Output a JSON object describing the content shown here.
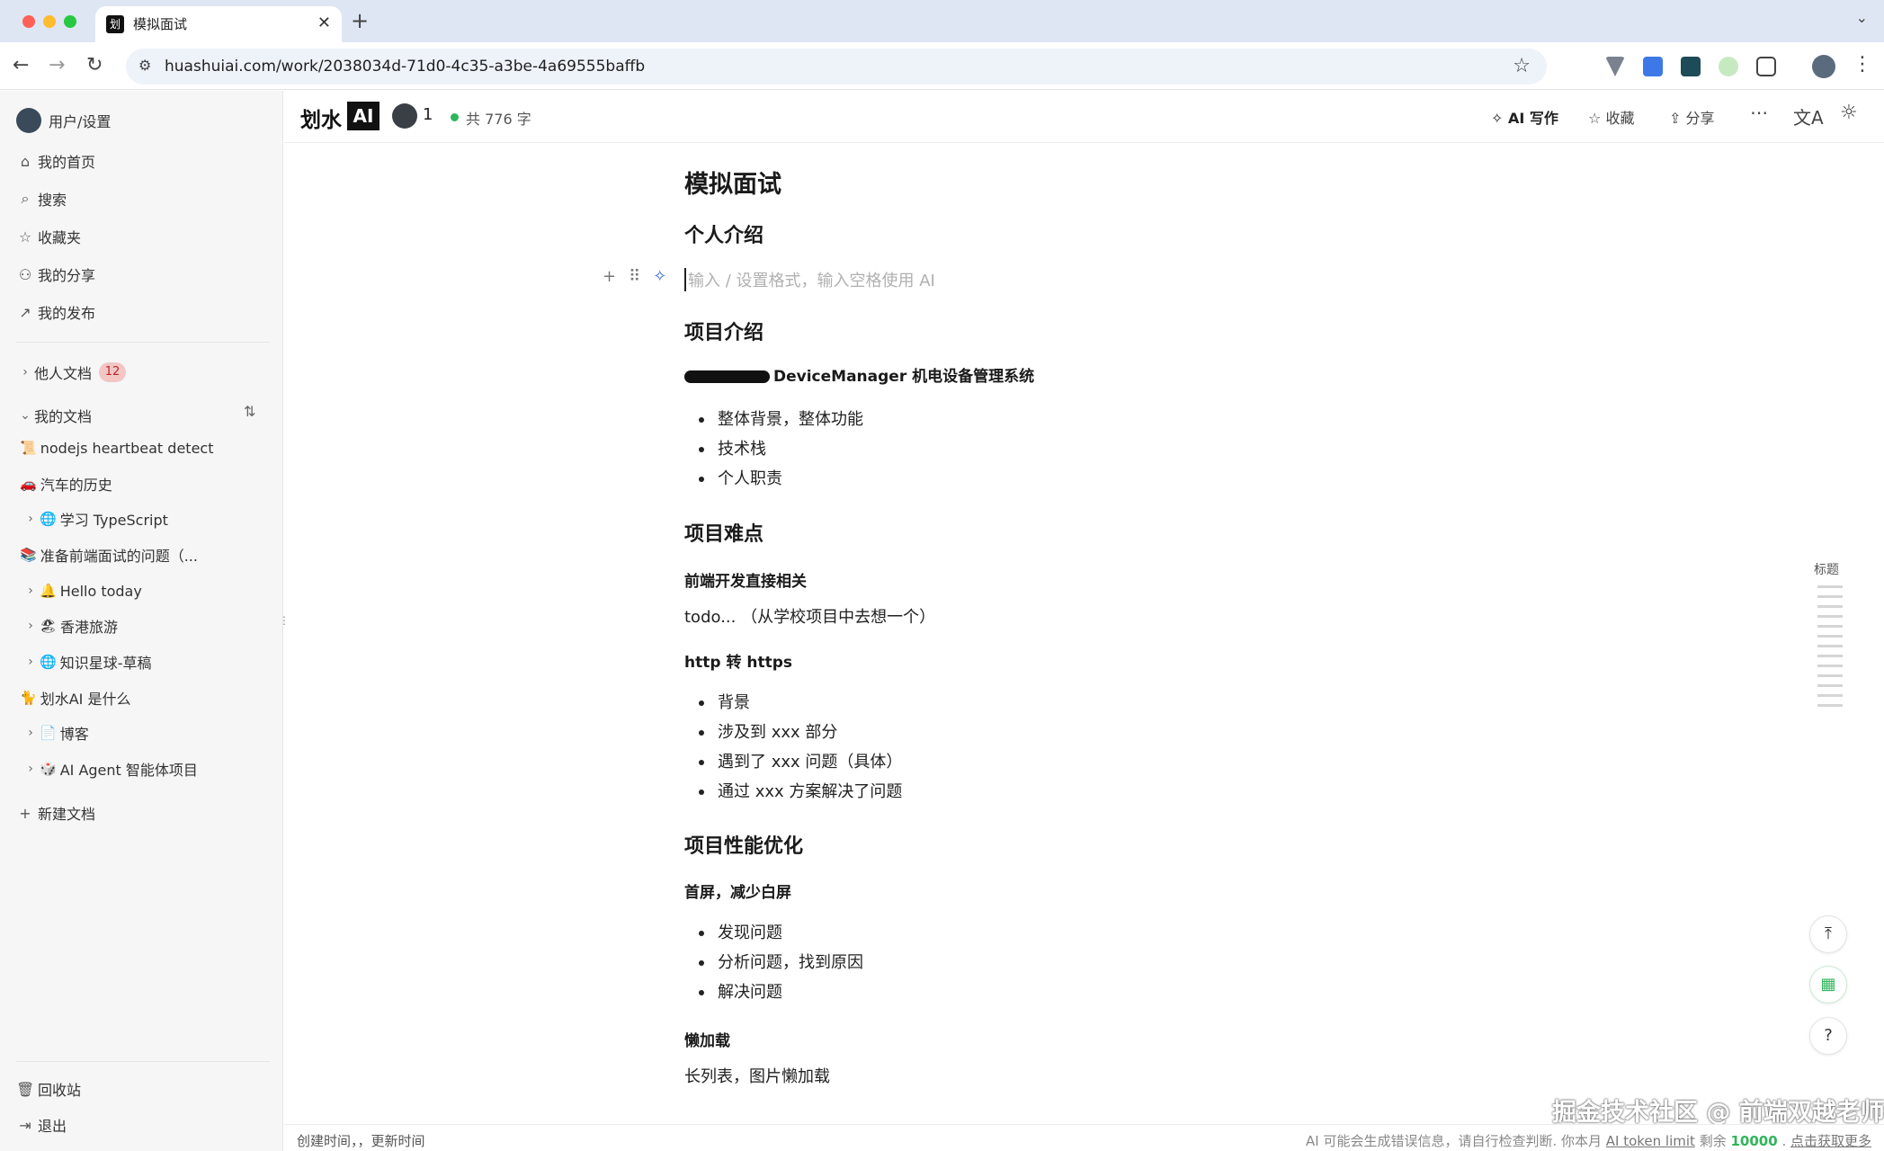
{
  "browser": {
    "tab_title": "模拟面试",
    "tab_favicon_char": "划",
    "url": "huashuiai.com/work/2038034d-71d0-4c35-a3be-4a69555baffb"
  },
  "sidebar": {
    "user": "用户/设置",
    "nav": [
      {
        "label": "我的首页",
        "icon": "home-icon"
      },
      {
        "label": "搜索",
        "icon": "search-icon"
      },
      {
        "label": "收藏夹",
        "icon": "star-icon"
      },
      {
        "label": "我的分享",
        "icon": "users-icon"
      },
      {
        "label": "我的发布",
        "icon": "external-link-icon"
      }
    ],
    "others_docs": {
      "label": "他人文档",
      "count": "12"
    },
    "my_docs": {
      "label": "我的文档"
    },
    "docs": [
      {
        "emoji": "📜",
        "label": "nodejs heartbeat detect",
        "expandable": false
      },
      {
        "emoji": "🚗",
        "label": "汽车的历史",
        "expandable": false
      },
      {
        "emoji": "🌐",
        "label": "学习 TypeScript",
        "expandable": true
      },
      {
        "emoji": "📚",
        "label": "准备前端面试的问题（...",
        "expandable": false
      },
      {
        "emoji": "🔔",
        "label": "Hello today",
        "expandable": true
      },
      {
        "emoji": "🏖",
        "label": "香港旅游",
        "expandable": true
      },
      {
        "emoji": "🌐",
        "label": "知识星球-草稿",
        "expandable": true
      },
      {
        "emoji": "🐈",
        "label": "划水AI 是什么",
        "expandable": false
      },
      {
        "emoji": "📄",
        "label": "博客",
        "expandable": true
      },
      {
        "emoji": "🎲",
        "label": "AI Agent 智能体项目",
        "expandable": true
      }
    ],
    "new_doc": "新建文档",
    "trash": "回收站",
    "logout": "退出"
  },
  "header": {
    "logo_text": "划水",
    "logo_ai": "AI",
    "collaborators": "1",
    "word_count": "共 776 字",
    "ai_write": "AI 写作",
    "favorite": "收藏",
    "share": "分享"
  },
  "doc": {
    "title": "模拟面试",
    "sec1": "个人介绍",
    "placeholder": "输入 / 设置格式，输入空格使用 AI",
    "sec2": "项目介绍",
    "project_name": "DeviceManager 机电设备管理系统",
    "project_bullets": [
      "整体背景，整体功能",
      "技术栈",
      "个人职责"
    ],
    "sec3": "项目难点",
    "sub1": "前端开发直接相关",
    "sub1_text": "todo... （从学校项目中去想一个）",
    "sub2": "http 转 https",
    "sub2_bullets": [
      "背景",
      "涉及到 xxx 部分",
      "遇到了 xxx 问题（具体）",
      "通过 xxx 方案解决了问题"
    ],
    "sec4": "项目性能优化",
    "sub3": "首屏，减少白屏",
    "sub3_bullets": [
      "发现问题",
      "分析问题，找到原因",
      "解决问题"
    ],
    "sub4": "懒加载",
    "sub4_text": "长列表，图片懒加载"
  },
  "outline": {
    "label": "标题"
  },
  "watermark": "掘金技术社区 @ 前端双越老师",
  "footer": {
    "left": "创建时间，，更新时间",
    "right_prefix": "AI 可能会生成错误信息，请自行检查判断. 你本月 ",
    "right_link": "AI token limit",
    "right_mid": " 剩余 ",
    "right_num": "10000",
    "right_sep": " . ",
    "right_more": "点击获取更多"
  },
  "colors": {
    "accent_green": "#30b55a",
    "badge_red": "#c02424",
    "ai_blue": "#3b6fe0"
  }
}
